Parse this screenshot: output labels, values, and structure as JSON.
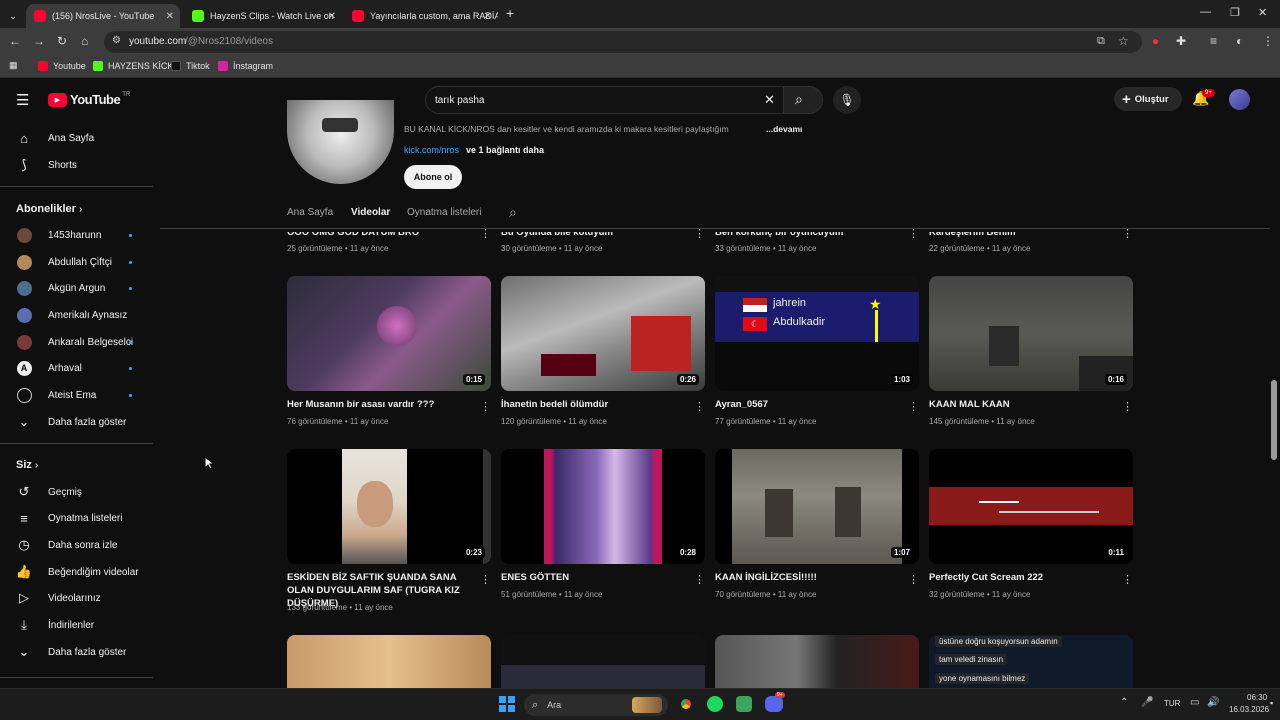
{
  "browser": {
    "tabs": [
      {
        "title": "(156) NrosLive - YouTube",
        "active": true
      },
      {
        "title": "HayzenS Clips - Watch Live on",
        "active": false
      },
      {
        "title": "Yayıncılarla custom, ama RADİA",
        "active": false
      }
    ],
    "url_host": "youtube.com",
    "url_path": "/@Nros2108/videos",
    "bookmarks": [
      "Youtube",
      "HAYZENS KİCK",
      "Tiktok",
      "İnstagram"
    ]
  },
  "youtube": {
    "logo": "YouTube",
    "region": "TR",
    "search_value": "tarık pasha",
    "create_label": "Oluştur",
    "notif_badge": "9+"
  },
  "channel": {
    "description": "BU KANAL KİCK/NROS dan kesitler ve kendi aramızda ki makara kesitleri paylaştığım",
    "more": "...devamı",
    "link": "kick.com/nros",
    "link_more": "ve 1 bağlantı daha",
    "subscribe": "Abone ol",
    "tabs": [
      "Ana Sayfa",
      "Videolar",
      "Oynatma listeleri"
    ]
  },
  "sidebar": {
    "main": [
      "Ana Sayfa",
      "Shorts"
    ],
    "subs_title": "Abonelikler",
    "subs": [
      "1453harunn",
      "Abdullah Çiftçi",
      "Akgün Argun",
      "Amerikalı Aynasız",
      "Ankaralı Belgeselci",
      "Arhaval",
      "Ateist Ema"
    ],
    "show_more": "Daha fazla göster",
    "you_title": "Siz",
    "you": [
      "Geçmiş",
      "Oynatma listeleri",
      "Daha sonra izle",
      "Beğendiğim videolar",
      "Videolarınız",
      "İndirilenler",
      "Daha fazla göster"
    ]
  },
  "videos_top": [
    {
      "title": "OOO OMG GOD DAYUM BRO",
      "meta": "25 görüntüleme • 11 ay önce"
    },
    {
      "title": "Bu Oyunda bile kötüyüm",
      "meta": "30 görüntüleme • 11 ay önce"
    },
    {
      "title": "Ben korkunç bir oyuncuyum",
      "meta": "33 görüntüleme • 11 ay önce"
    },
    {
      "title": "Kardeşlerim Benim",
      "meta": "22 görüntüleme • 11 ay önce"
    }
  ],
  "videos_row1": [
    {
      "title": "Her Musanın bir asası vardır ???",
      "meta": "76 görüntüleme • 11 ay önce",
      "dur": "0:15"
    },
    {
      "title": "İhanetin bedeli ölümdür",
      "meta": "120 görüntüleme • 11 ay önce",
      "dur": "0:26"
    },
    {
      "title": "Ayran_0567",
      "meta": "77 görüntüleme • 11 ay önce",
      "dur": "1:03"
    },
    {
      "title": "KAAN MAL KAAN",
      "meta": "145 görüntüleme • 11 ay önce",
      "dur": "0:16"
    }
  ],
  "videos_row2": [
    {
      "title": "ESKİDEN BİZ SAFTIK ŞUANDA SANA OLAN DUYGULARIM SAF (TUGRA KIZ DÜŞÜRME)",
      "meta": "133 görüntüleme • 11 ay önce",
      "dur": "0:23"
    },
    {
      "title": "ENES GÖTTEN",
      "meta": "51 görüntüleme • 11 ay önce",
      "dur": "0:28"
    },
    {
      "title": "KAAN İNGİLİZCESİ!!!!!",
      "meta": "70 görüntüleme • 11 ay önce",
      "dur": "1:07"
    },
    {
      "title": "Perfectly Cut Scream 222",
      "meta": "32 görüntüleme • 11 ay önce",
      "dur": "0:11"
    }
  ],
  "thumb_text": {
    "ayran_1": "jahrein",
    "ayran_2": "Abdulkadir",
    "subtitle_1": "üstüne doğru koşuyorsun adamın",
    "subtitle_2": "tam veledi zinasın",
    "subtitle_3": "yone oynamasını bilmez"
  },
  "taskbar": {
    "search": "Ara",
    "lang": "TUR",
    "time": "06:30",
    "date": "16.03.2026",
    "discord_badge": "9+"
  },
  "colors": {
    "accent": "#3ea6ff",
    "yt_red": "#ff0033",
    "bg": "#0f0f0f"
  }
}
